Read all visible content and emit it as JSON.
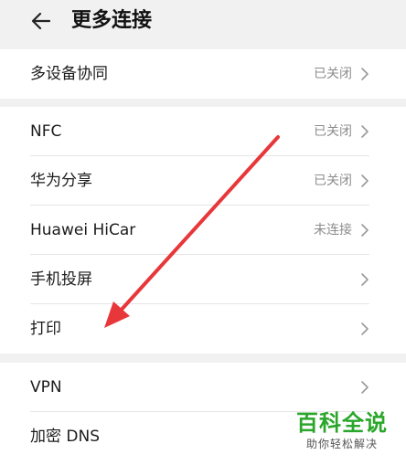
{
  "header": {
    "title": "更多连接",
    "back_icon": "arrow-left-icon"
  },
  "group1": {
    "items": [
      {
        "label": "多设备协同",
        "value": "已关闭"
      }
    ]
  },
  "group2": {
    "items": [
      {
        "label": "NFC",
        "value": "已关闭"
      },
      {
        "label": "华为分享",
        "value": "已关闭"
      },
      {
        "label": "Huawei HiCar",
        "value": "未连接"
      },
      {
        "label": "手机投屏",
        "value": ""
      },
      {
        "label": "打印",
        "value": ""
      }
    ]
  },
  "group3": {
    "items": [
      {
        "label": "VPN",
        "value": ""
      },
      {
        "label": "加密 DNS",
        "value": ""
      }
    ]
  },
  "annotation": {
    "arrow_color": "#e8373a"
  },
  "watermark": {
    "title": "百科全说",
    "subtitle": "助你轻松解决",
    "color": "#2aa62a"
  }
}
